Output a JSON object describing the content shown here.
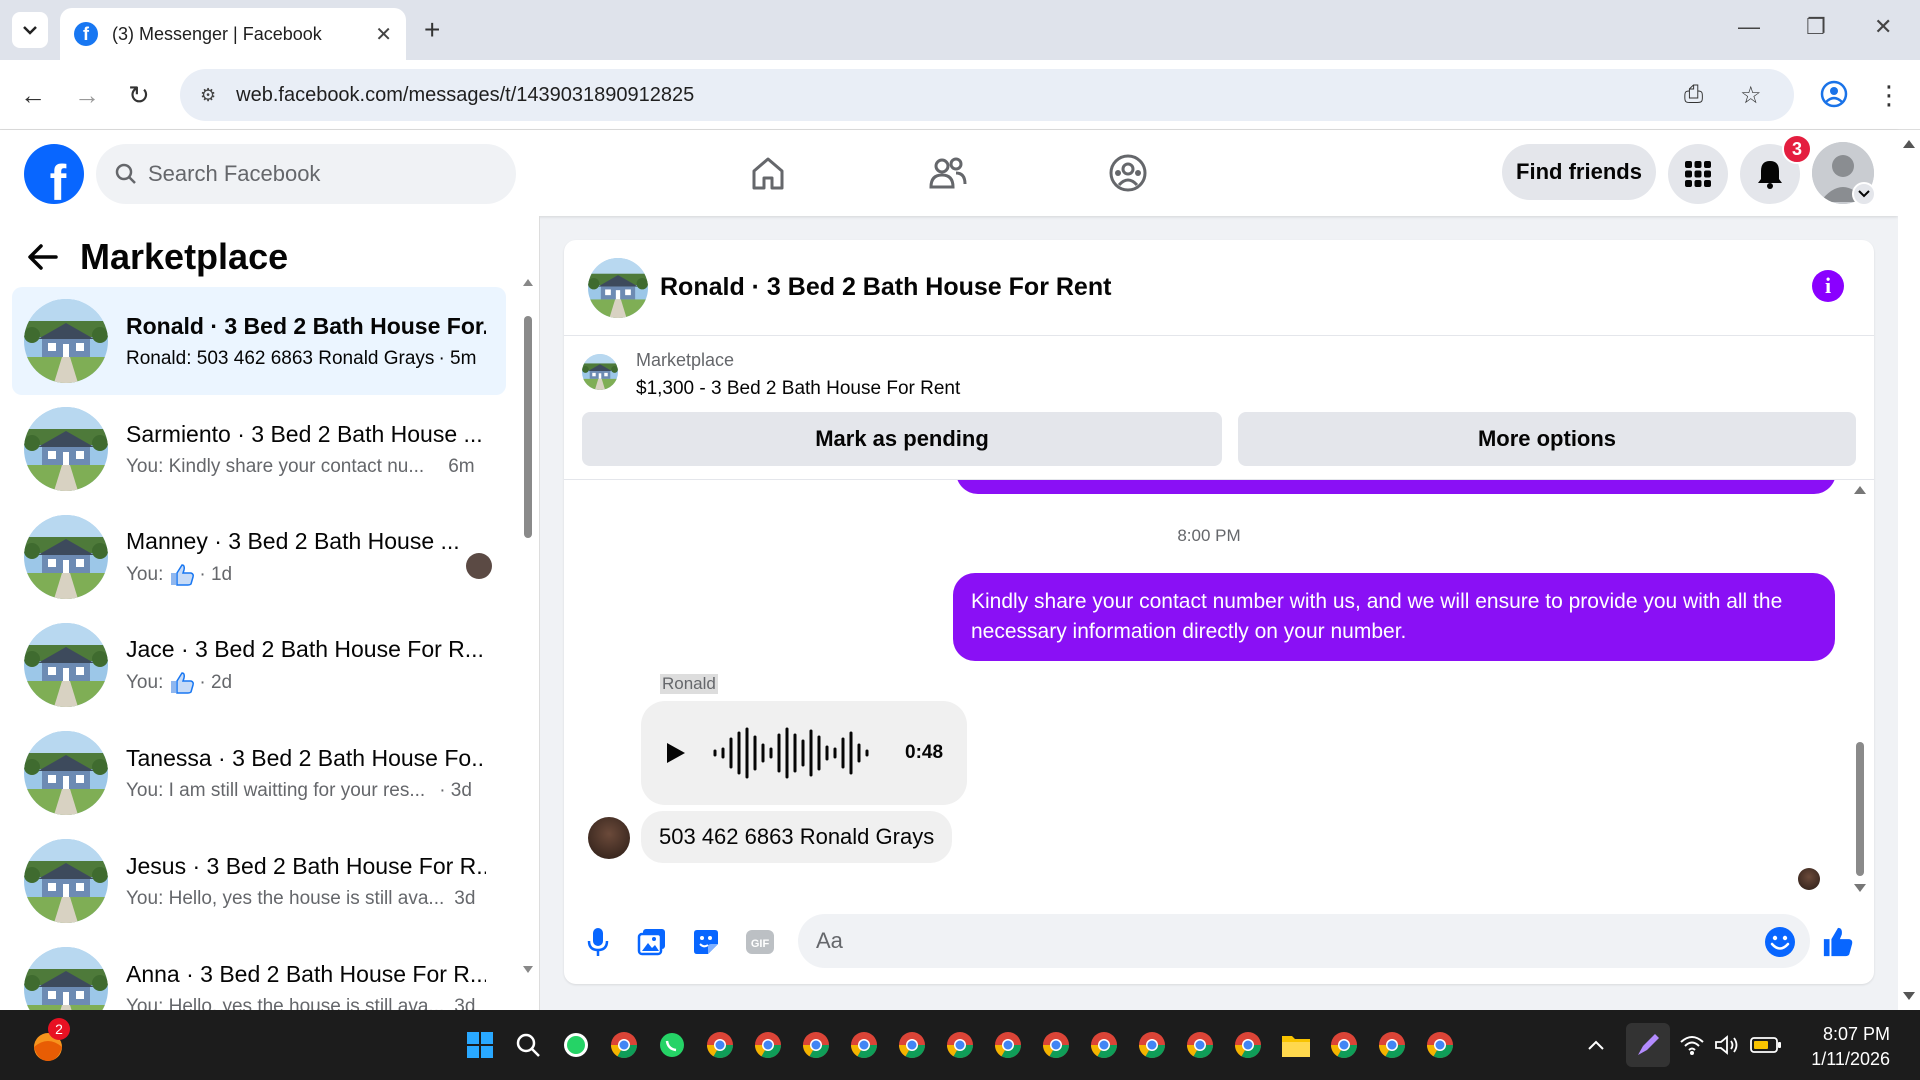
{
  "browser": {
    "tab_title": "(3) Messenger | Facebook",
    "url": "web.facebook.com/messages/t/1439031890912825"
  },
  "header": {
    "search_placeholder": "Search Facebook",
    "find_friends_label": "Find friends",
    "notification_count": "3"
  },
  "sidebar": {
    "title": "Marketplace",
    "conversations": [
      {
        "title": "Ronald · 3 Bed 2 Bath House For...",
        "snippet": "Ronald: 503 462 6863 Ronald Grays",
        "time": "· 5m",
        "active": true,
        "unread": true
      },
      {
        "title": "Sarmiento · 3 Bed 2 Bath House ...",
        "snippet": "You: Kindly share your contact nu...",
        "time": "6m"
      },
      {
        "title": "Manney · 3 Bed 2 Bath House ...",
        "snippet": "You:",
        "time": "· 1d"
      },
      {
        "title": "Jace · 3 Bed 2 Bath House For R...",
        "snippet": "You:",
        "time": "· 2d"
      },
      {
        "title": "Tanessa · 3 Bed 2 Bath House Fo...",
        "snippet": "You: I am still waitting for your res...",
        "time": "· 3d"
      },
      {
        "title": "Jesus · 3 Bed 2 Bath House For R...",
        "snippet": "You: Hello, yes the house is still ava...",
        "time": "3d"
      },
      {
        "title": "Anna · 3 Bed 2 Bath House For R...",
        "snippet": "You: Hello, yes the house is still ava...",
        "time": "3d"
      }
    ]
  },
  "chat": {
    "title": "Ronald · 3 Bed 2 Bath House For Rent",
    "marketplace_label": "Marketplace",
    "listing": "$1,300 - 3 Bed 2 Bath House For Rent",
    "mark_pending_label": "Mark as pending",
    "more_options_label": "More options",
    "timestamp": "8:00 PM",
    "outgoing_message": "Kindly share your contact number with us, and we will ensure to provide you with all the necessary information directly on your number.",
    "sender_name": "Ronald",
    "audio_duration": "0:48",
    "incoming_message": "503 462 6863 Ronald Grays",
    "composer_placeholder": "Aa"
  },
  "taskbar": {
    "widget_badge": "2",
    "time": "8:07 PM",
    "date": "1/11/2026"
  },
  "colors": {
    "fb_blue": "#0866ff",
    "message_purple": "#8a10f5",
    "active_conv_bg": "#ebf5ff"
  }
}
